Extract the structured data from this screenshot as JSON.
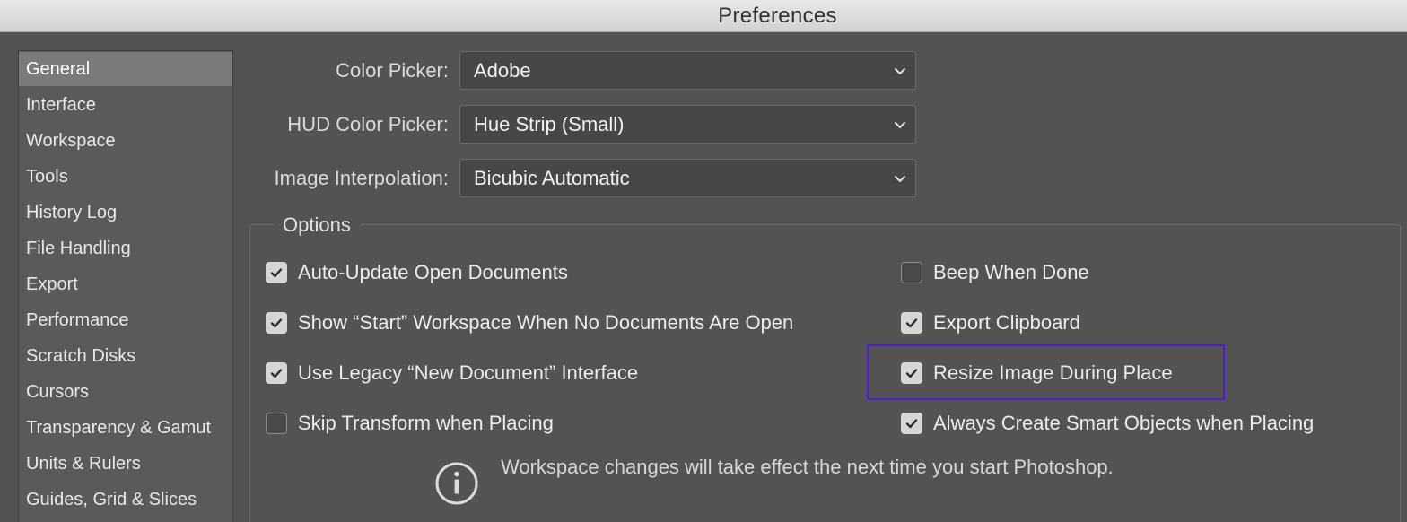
{
  "window": {
    "title": "Preferences"
  },
  "sidebar": {
    "items": [
      {
        "label": "General",
        "selected": true
      },
      {
        "label": "Interface"
      },
      {
        "label": "Workspace"
      },
      {
        "label": "Tools"
      },
      {
        "label": "History Log"
      },
      {
        "label": "File Handling"
      },
      {
        "label": "Export"
      },
      {
        "label": "Performance"
      },
      {
        "label": "Scratch Disks"
      },
      {
        "label": "Cursors"
      },
      {
        "label": "Transparency & Gamut"
      },
      {
        "label": "Units & Rulers"
      },
      {
        "label": "Guides, Grid & Slices"
      }
    ]
  },
  "fields": {
    "color_picker": {
      "label": "Color Picker:",
      "value": "Adobe"
    },
    "hud_color_picker": {
      "label": "HUD Color Picker:",
      "value": "Hue Strip (Small)"
    },
    "image_interpolation": {
      "label": "Image Interpolation:",
      "value": "Bicubic Automatic"
    }
  },
  "options": {
    "legend": "Options",
    "left": [
      {
        "label": "Auto-Update Open Documents",
        "checked": true
      },
      {
        "label": "Show “Start” Workspace When No Documents Are Open",
        "checked": true
      },
      {
        "label": "Use Legacy “New Document” Interface",
        "checked": true
      },
      {
        "label": "Skip Transform when Placing",
        "checked": false
      }
    ],
    "right": [
      {
        "label": "Beep When Done",
        "checked": false
      },
      {
        "label": "Export Clipboard",
        "checked": true
      },
      {
        "label": "Resize Image During Place",
        "checked": true,
        "highlighted": true
      },
      {
        "label": "Always Create Smart Objects when Placing",
        "checked": true
      }
    ]
  },
  "info": {
    "icon": "info-icon",
    "text": "Workspace changes will take effect the next time you start Photoshop."
  },
  "colors": {
    "panel_bg": "#535353",
    "selected_item_bg": "#7a7a7a",
    "highlight_border": "#4b1fd6"
  }
}
